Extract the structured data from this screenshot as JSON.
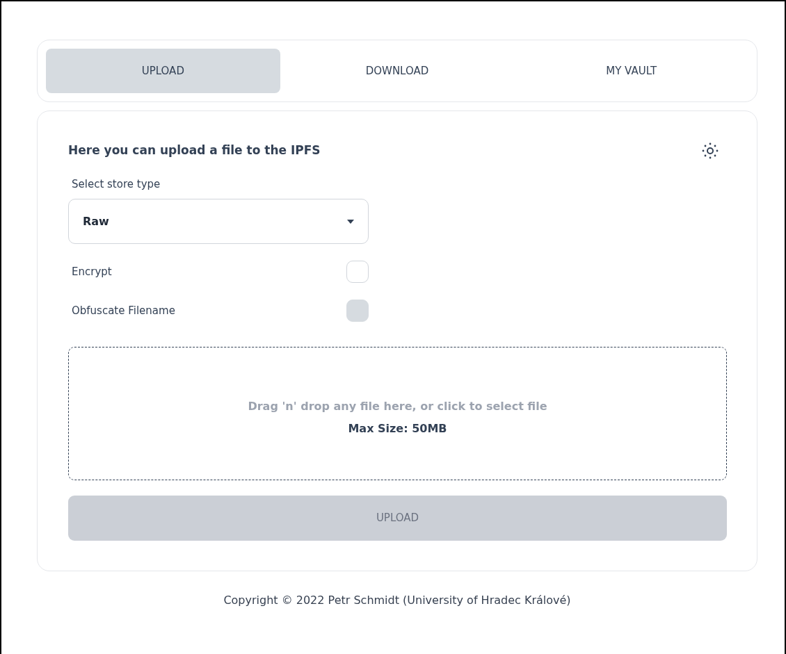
{
  "tabs": [
    {
      "label": "UPLOAD",
      "selected": true
    },
    {
      "label": "DOWNLOAD",
      "selected": false
    },
    {
      "label": "MY VAULT",
      "selected": false
    }
  ],
  "upload_panel": {
    "heading": "Here you can upload a file to the IPFS",
    "store_type": {
      "label": "Select store type",
      "value": "Raw"
    },
    "options": [
      {
        "label": "Encrypt",
        "checked": false,
        "disabled": false
      },
      {
        "label": "Obfuscate Filename",
        "checked": false,
        "disabled": true
      }
    ],
    "dropzone": {
      "prompt": "Drag 'n' drop any file here, or click to select file",
      "limit": "Max Size: 50MB"
    },
    "upload_button": {
      "label": "UPLOAD",
      "disabled": true
    }
  },
  "footer": "Copyright © 2022 Petr Schmidt (University of Hradec Králové)"
}
